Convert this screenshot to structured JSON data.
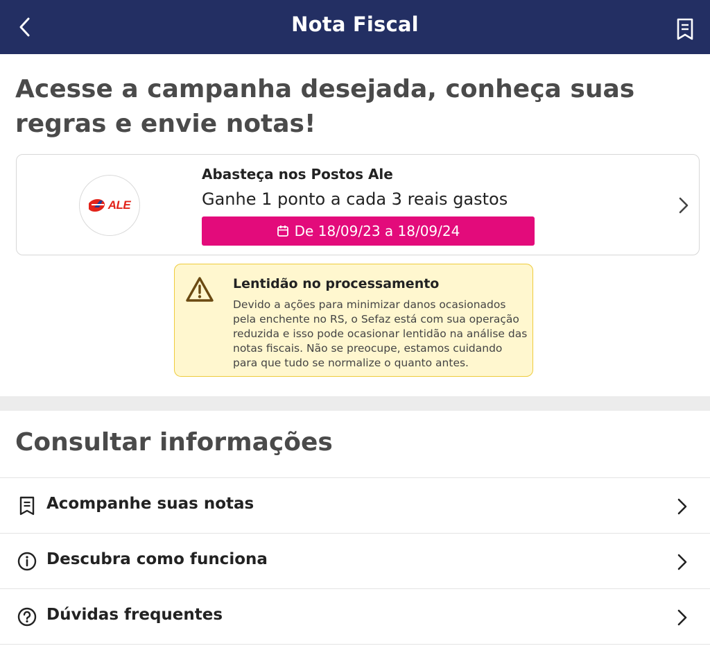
{
  "header": {
    "title": "Nota Fiscal",
    "back_icon": "chevron-left-icon",
    "receipt_icon": "receipt-icon",
    "background": "#232f63"
  },
  "headline": "Acesse a campanha desejada, conheça suas regras e envie notas!",
  "campaign": {
    "logo_text": "ALE",
    "name": "Abasteça nos Postos Ale",
    "description": "Ganhe 1 ponto a cada 3 reais gastos",
    "period": "De 18/09/23 a 18/09/24",
    "period_color": "#e30b7b"
  },
  "alert": {
    "title": "Lentidão no processamento",
    "body": "Devido a ações para minimizar danos ocasionados pela enchente no RS, o Sefaz está com sua operação reduzida e isso pode ocasionar lentidão na análise das notas fiscais. Não se preocupe, estamos cuidando para que tudo se normalize o quanto antes.",
    "background": "#fff7cf",
    "border": "#eecb3c"
  },
  "info": {
    "title": "Consultar informações",
    "items": [
      {
        "label": "Acompanhe suas notas",
        "icon": "receipt-icon"
      },
      {
        "label": "Descubra como funciona",
        "icon": "info-icon"
      },
      {
        "label": "Dúvidas frequentes",
        "icon": "help-icon"
      }
    ]
  }
}
